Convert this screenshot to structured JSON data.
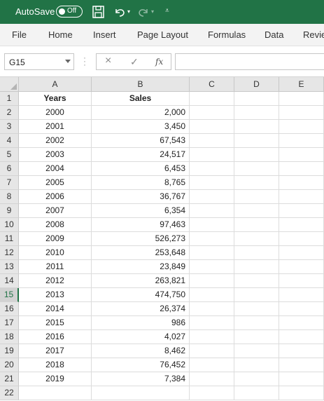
{
  "titlebar": {
    "autosave_label": "AutoSave",
    "autosave_state": "Off",
    "icons": [
      "save-icon",
      "undo-icon",
      "redo-icon",
      "customize-quick-access-icon"
    ]
  },
  "ribbon": {
    "tabs": [
      "File",
      "Home",
      "Insert",
      "Page Layout",
      "Formulas",
      "Data",
      "Revie"
    ]
  },
  "formula_bar": {
    "name_box": "G15",
    "cancel_icon": "×",
    "enter_icon": "✓",
    "fx_label": "fx",
    "formula": ""
  },
  "sheet": {
    "columns": [
      "A",
      "B",
      "C",
      "D",
      "E"
    ],
    "active_row": 15,
    "rows": [
      {
        "num": "1",
        "a": "Years",
        "b": "Sales"
      },
      {
        "num": "2",
        "a": "2000",
        "b": "2,000"
      },
      {
        "num": "3",
        "a": "2001",
        "b": "3,450"
      },
      {
        "num": "4",
        "a": "2002",
        "b": "67,543"
      },
      {
        "num": "5",
        "a": "2003",
        "b": "24,517"
      },
      {
        "num": "6",
        "a": "2004",
        "b": "6,453"
      },
      {
        "num": "7",
        "a": "2005",
        "b": "8,765"
      },
      {
        "num": "8",
        "a": "2006",
        "b": "36,767"
      },
      {
        "num": "9",
        "a": "2007",
        "b": "6,354"
      },
      {
        "num": "10",
        "a": "2008",
        "b": "97,463"
      },
      {
        "num": "11",
        "a": "2009",
        "b": "526,273"
      },
      {
        "num": "12",
        "a": "2010",
        "b": "253,648"
      },
      {
        "num": "13",
        "a": "2011",
        "b": "23,849"
      },
      {
        "num": "14",
        "a": "2012",
        "b": "263,821"
      },
      {
        "num": "15",
        "a": "2013",
        "b": "474,750"
      },
      {
        "num": "16",
        "a": "2014",
        "b": "26,374"
      },
      {
        "num": "17",
        "a": "2015",
        "b": "986"
      },
      {
        "num": "18",
        "a": "2016",
        "b": "4,027"
      },
      {
        "num": "19",
        "a": "2017",
        "b": "8,462"
      },
      {
        "num": "20",
        "a": "2018",
        "b": "76,452"
      },
      {
        "num": "21",
        "a": "2019",
        "b": "7,384"
      },
      {
        "num": "22",
        "a": "",
        "b": ""
      }
    ]
  }
}
